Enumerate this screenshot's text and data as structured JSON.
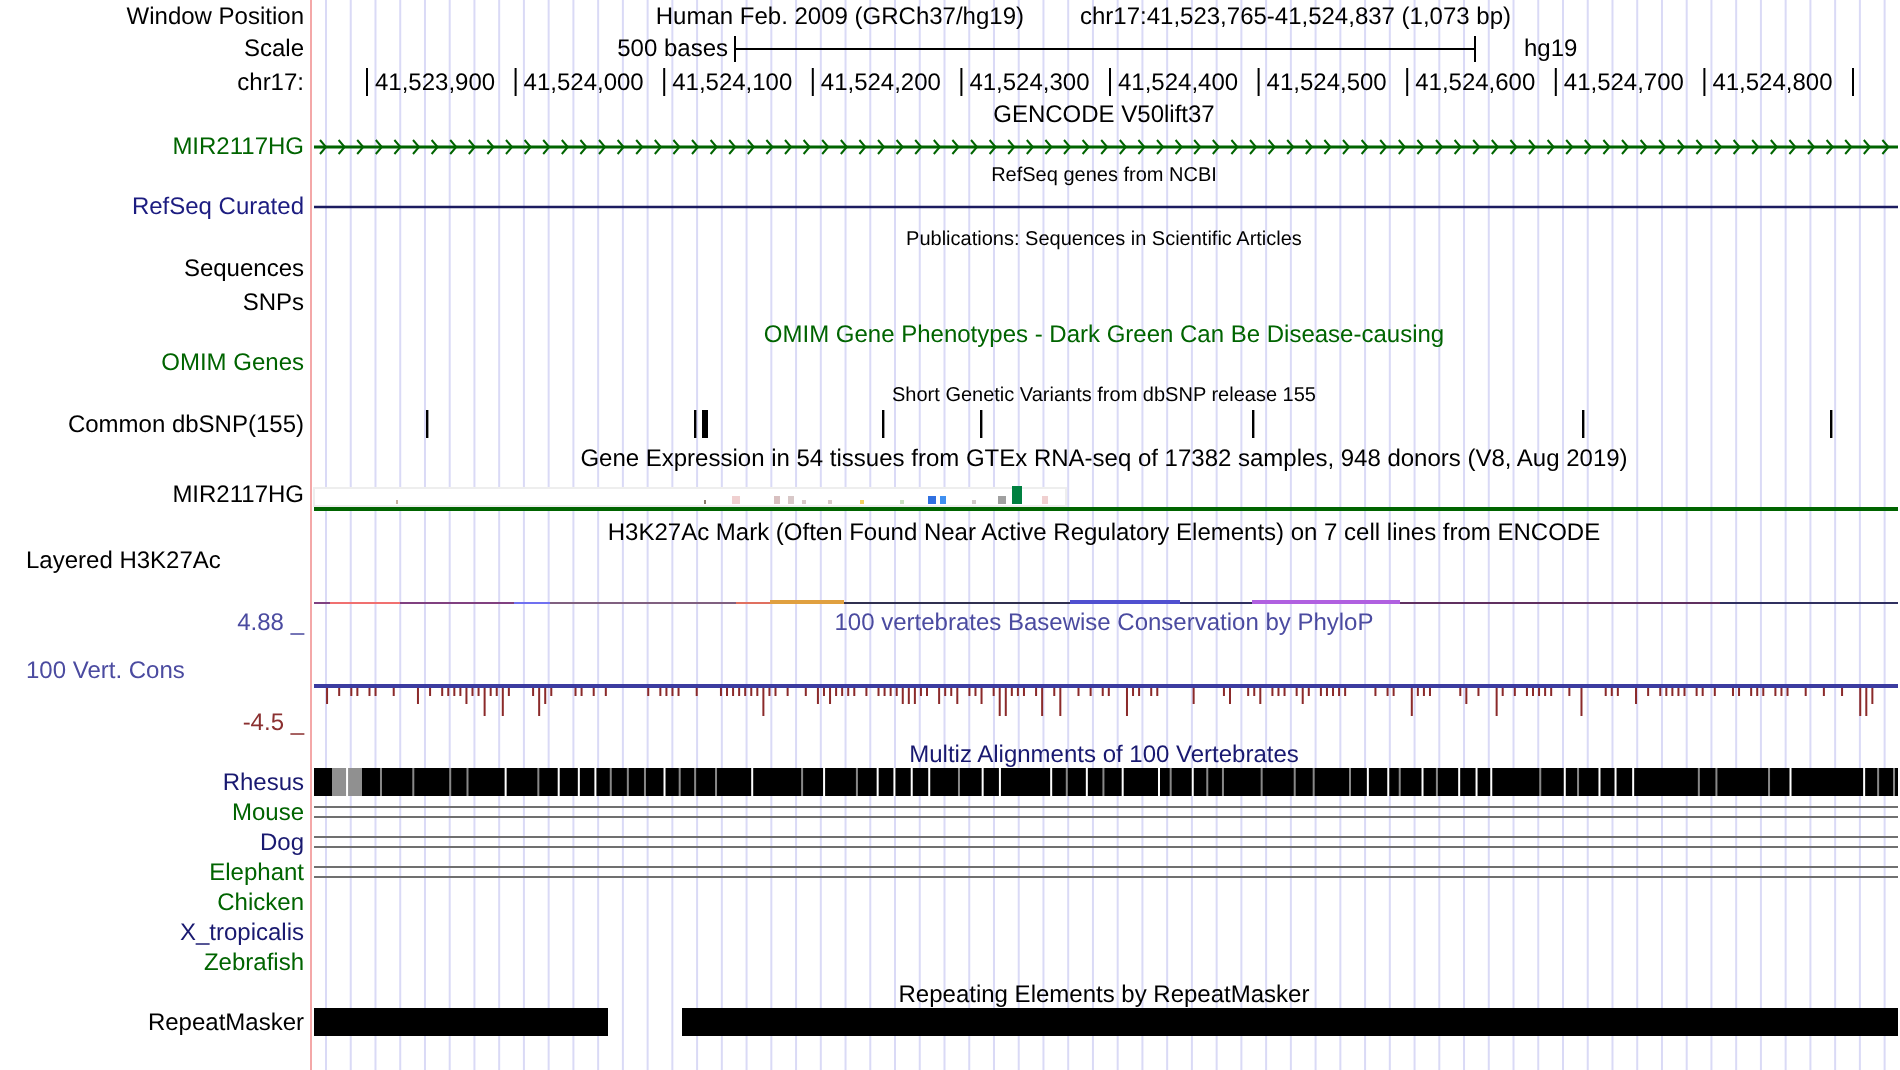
{
  "header": {
    "window_position_label": "Window Position",
    "assembly": "Human Feb. 2009 (GRCh37/hg19)",
    "position": "chr17:41,523,765-41,524,837 (1,073 bp)",
    "scale_label": "Scale",
    "scale_text": "500 bases",
    "scale_assembly": "hg19",
    "chrom_label": "chr17:",
    "ticks": [
      "41,523,900",
      "41,524,000",
      "41,524,100",
      "41,524,200",
      "41,524,300",
      "41,524,400",
      "41,524,500",
      "41,524,600",
      "41,524,700",
      "41,524,800"
    ]
  },
  "tracks": [
    {
      "kind": "gene",
      "title": "GENCODE V50lift37",
      "labels": [
        {
          "text": "MIR2117HG",
          "color": "#006400"
        }
      ]
    },
    {
      "kind": "refseq",
      "title": "RefSeq genes from NCBI",
      "labels": [
        {
          "text": "RefSeq Curated",
          "color": "#1c1c80"
        }
      ]
    },
    {
      "kind": "pubs",
      "title": "Publications: Sequences in Scientific Articles",
      "labels": [
        {
          "text": "Sequences",
          "color": "#000000"
        },
        {
          "text": "SNPs",
          "color": "#000000"
        }
      ]
    },
    {
      "kind": "omim",
      "title": "OMIM Gene Phenotypes - Dark Green Can Be Disease-causing",
      "labels": [
        {
          "text": "OMIM Genes",
          "color": "#006400"
        }
      ]
    },
    {
      "kind": "snp",
      "title": "Short Genetic Variants from dbSNP release 155",
      "labels": [
        {
          "text": "Common dbSNP(155)",
          "color": "#000000"
        }
      ]
    },
    {
      "kind": "expression",
      "title": "Gene Expression in 54 tissues from GTEx RNA-seq of 17382 samples, 948 donors (V8, Aug 2019)",
      "labels": [
        {
          "text": "MIR2117HG",
          "color": "#000000"
        }
      ]
    },
    {
      "kind": "layered",
      "title": "H3K27Ac Mark (Often Found Near Active Regulatory Elements) on 7 cell lines from ENCODE",
      "labels": [
        {
          "text": "Layered H3K27Ac",
          "color": "#000000"
        }
      ]
    },
    {
      "kind": "conservation",
      "title": "100 vertebrates Basewise Conservation by PhyloP",
      "labels": [
        {
          "text": "4.88 _",
          "color": "#4b4ba0"
        },
        {
          "text": "100 Vert. Cons",
          "color": "#4b4ba0"
        },
        {
          "text": "-4.5 _",
          "color": "#8b3030"
        }
      ]
    },
    {
      "kind": "multiz",
      "title": "Multiz Alignments of 100 Vertebrates",
      "labels": [
        {
          "text": "Rhesus",
          "color": "#191970"
        },
        {
          "text": "Mouse",
          "color": "#006400"
        },
        {
          "text": "Dog",
          "color": "#191970"
        },
        {
          "text": "Elephant",
          "color": "#006400"
        },
        {
          "text": "Chicken",
          "color": "#006400"
        },
        {
          "text": "X_tropicalis",
          "color": "#191970"
        },
        {
          "text": "Zebrafish",
          "color": "#006400"
        }
      ]
    },
    {
      "kind": "repeat",
      "title": "Repeating Elements by RepeatMasker",
      "labels": [
        {
          "text": "RepeatMasker",
          "color": "#000000"
        }
      ]
    }
  ]
}
